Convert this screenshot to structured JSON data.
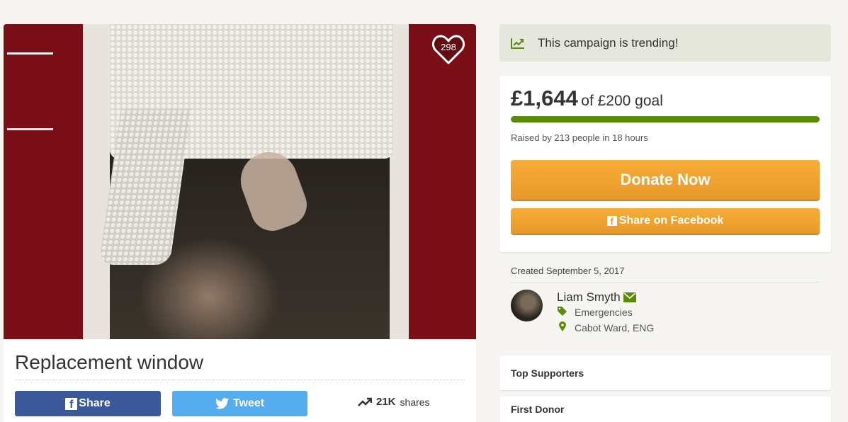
{
  "campaign": {
    "title": "Replacement window",
    "heart_count": "298"
  },
  "social": {
    "share_label": "Share",
    "tweet_label": "Tweet",
    "shares_count": "21K",
    "shares_label": "shares"
  },
  "trending": {
    "text": "This campaign is trending!"
  },
  "goal": {
    "amount": "£1,644",
    "goal_text": "of £200 goal",
    "progress_fraction": 1.0,
    "raised_text": "Raised by 213 people in 18 hours",
    "donate_label": "Donate Now",
    "share_fb_label": "Share on Facebook"
  },
  "organizer": {
    "created_text": "Created September 5, 2017",
    "name": "Liam Smyth",
    "category": "Emergencies",
    "location": "Cabot Ward, ENG"
  },
  "panels": {
    "top_supporters": "Top Supporters",
    "first_donor": "First Donor"
  },
  "colors": {
    "progress": "#5d8a06",
    "donate": "#f0a235",
    "facebook": "#3b5998",
    "twitter": "#55acee"
  }
}
